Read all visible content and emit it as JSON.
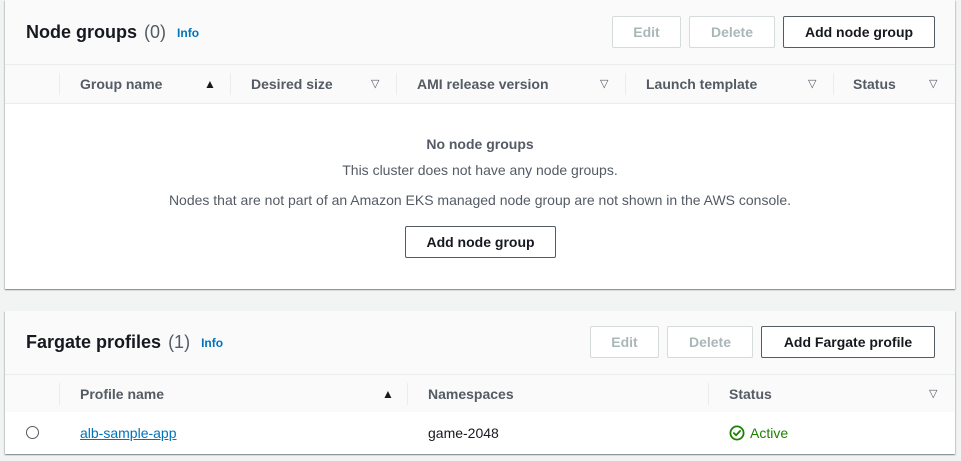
{
  "node_groups": {
    "title": "Node groups",
    "count": "(0)",
    "info_label": "Info",
    "buttons": {
      "edit": "Edit",
      "delete": "Delete",
      "add": "Add node group"
    },
    "columns": [
      "Group name",
      "Desired size",
      "AMI release version",
      "Launch template",
      "Status"
    ],
    "sort_column": "Group name",
    "empty": {
      "title": "No node groups",
      "line1": "This cluster does not have any node groups.",
      "line2": "Nodes that are not part of an Amazon EKS managed node group are not shown in the AWS console.",
      "button": "Add node group"
    }
  },
  "fargate_profiles": {
    "title": "Fargate profiles",
    "count": "(1)",
    "info_label": "Info",
    "buttons": {
      "edit": "Edit",
      "delete": "Delete",
      "add": "Add Fargate profile"
    },
    "columns": [
      "Profile name",
      "Namespaces",
      "Status"
    ],
    "sort_column": "Profile name",
    "rows": [
      {
        "profile_name": "alb-sample-app",
        "namespaces": "game-2048",
        "status": "Active",
        "selected": false
      }
    ]
  },
  "icons": {
    "sort_ascending": "triangle-up-icon",
    "sort_unsorted": "caret-down-icon",
    "status_success": "check-circle-icon",
    "radio": "radio-button-icon"
  },
  "colors": {
    "link": "#0073bb",
    "success": "#1d8102",
    "disabled": "#aab7b8"
  }
}
